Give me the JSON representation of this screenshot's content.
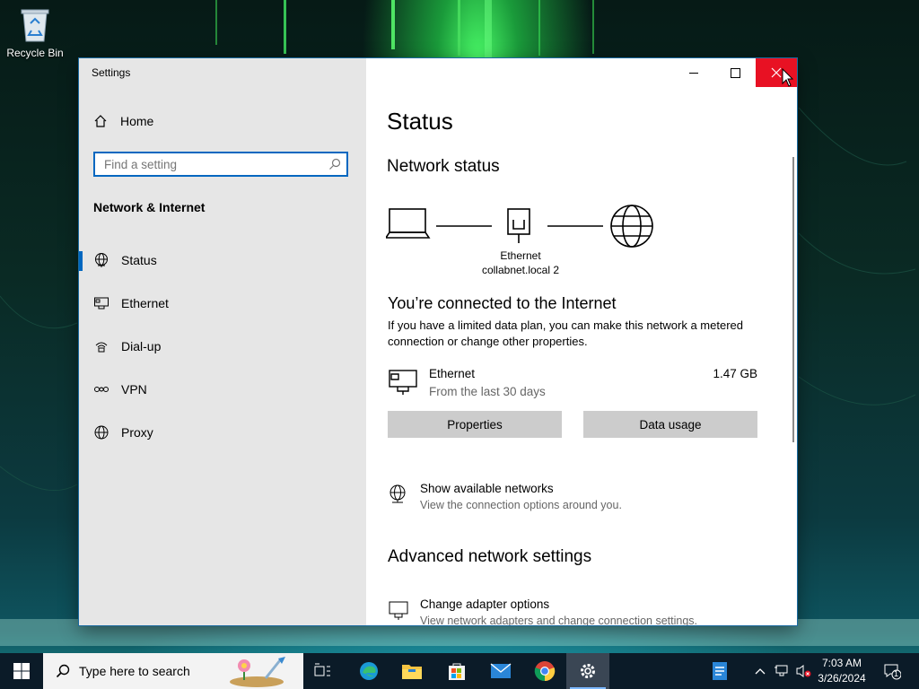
{
  "desktop": {
    "icons": [
      {
        "label": "Recycle Bin",
        "icon": "recycle-bin-icon"
      }
    ]
  },
  "window": {
    "title": "Settings",
    "controls": {
      "minimize": "minimize-icon",
      "maximize": "maximize-icon",
      "close": "close-icon"
    }
  },
  "sidebar": {
    "home_label": "Home",
    "search_placeholder": "Find a setting",
    "section_title": "Network & Internet",
    "items": [
      {
        "label": "Status",
        "icon": "globe-status-icon",
        "active": true
      },
      {
        "label": "Ethernet",
        "icon": "ethernet-icon",
        "active": false
      },
      {
        "label": "Dial-up",
        "icon": "dialup-icon",
        "active": false
      },
      {
        "label": "VPN",
        "icon": "vpn-icon",
        "active": false
      },
      {
        "label": "Proxy",
        "icon": "globe-icon",
        "active": false
      }
    ]
  },
  "content": {
    "title": "Status",
    "network_status_heading": "Network status",
    "diagram": {
      "adapter_label": "Ethernet",
      "network_label": "collabnet.local 2"
    },
    "connected_heading": "You’re connected to the Internet",
    "connected_desc": "If you have a limited data plan, you can make this network a metered connection or change other properties.",
    "ethernet": {
      "name": "Ethernet",
      "subtitle": "From the last 30 days",
      "usage": "1.47 GB"
    },
    "buttons": {
      "properties": "Properties",
      "data_usage": "Data usage"
    },
    "show_networks": {
      "title": "Show available networks",
      "subtitle": "View the connection options around you."
    },
    "advanced_heading": "Advanced network settings",
    "adapter_options": {
      "title": "Change adapter options",
      "subtitle": "View network adapters and change connection settings."
    }
  },
  "taskbar": {
    "search_placeholder": "Type here to search",
    "apps": [
      "task-view-icon",
      "edge-icon",
      "file-explorer-icon",
      "store-icon",
      "mail-icon",
      "chrome-icon",
      "settings-icon",
      "notepad-icon"
    ],
    "active_app": "settings-icon",
    "clock": {
      "time": "7:03 AM",
      "date": "3/26/2024"
    },
    "notifications_count": "1"
  },
  "colors": {
    "accent": "#0067c0",
    "close_red": "#e81123",
    "sidebar_bg": "#e6e6e6",
    "taskbar_bg": "#0b1b28"
  }
}
